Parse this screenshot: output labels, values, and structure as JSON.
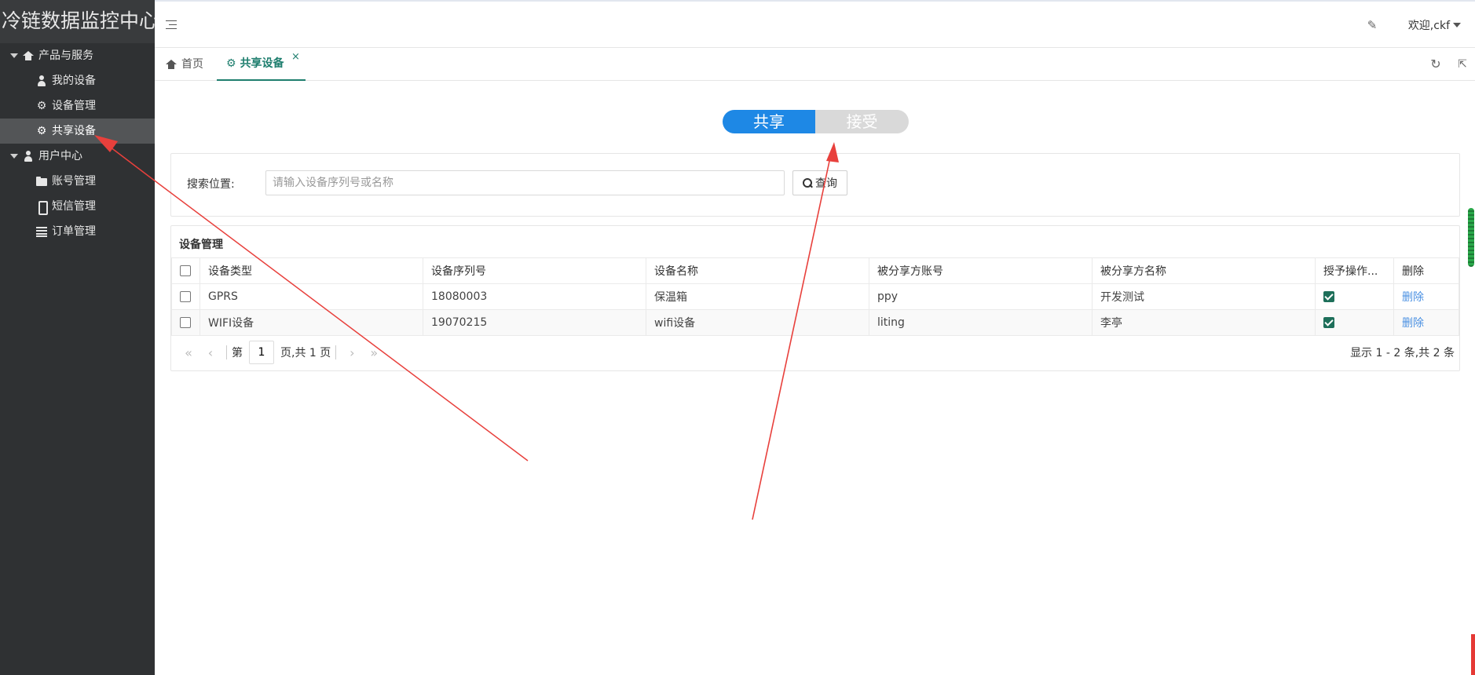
{
  "app": {
    "title": "冷链数据监控中心"
  },
  "sidebar": {
    "groups": [
      {
        "label": "产品与服务",
        "items": [
          {
            "label": "我的设备"
          },
          {
            "label": "设备管理"
          },
          {
            "label": "共享设备"
          }
        ]
      },
      {
        "label": "用户中心",
        "items": [
          {
            "label": "账号管理"
          },
          {
            "label": "短信管理"
          },
          {
            "label": "订单管理"
          }
        ]
      }
    ]
  },
  "header": {
    "welcome": "欢迎,ckf"
  },
  "tabs": [
    {
      "label": "首页"
    },
    {
      "label": "共享设备",
      "close": "×"
    }
  ],
  "toggle": {
    "share": "共享",
    "receive": "接受"
  },
  "search": {
    "label": "搜索位置:",
    "placeholder": "请输入设备序列号或名称",
    "value": "",
    "button": "查询"
  },
  "table": {
    "title": "设备管理",
    "columns": [
      "设备类型",
      "设备序列号",
      "设备名称",
      "被分享方账号",
      "被分享方名称",
      "授予操作...",
      "删除"
    ],
    "rows": [
      {
        "type": "GPRS",
        "serial": "18080003",
        "name": "保温箱",
        "account": "ppy",
        "account_name": "开发测试",
        "granted": true,
        "delete": "删除"
      },
      {
        "type": "WIFI设备",
        "serial": "19070215",
        "name": "wifi设备",
        "account": "liting",
        "account_name": "李亭",
        "granted": true,
        "delete": "删除"
      }
    ]
  },
  "pagination": {
    "prefix": "第",
    "page": "1",
    "suffix": "页,共 1 页",
    "info": "显示 1 - 2 条,共 2 条"
  },
  "colors": {
    "sidebar_bg": "#2f3133",
    "accent_tab": "#1e7e6e",
    "toggle_on": "#1e88e5",
    "toggle_off": "#d9d9d9",
    "link": "#4a90e2",
    "annotation": "#e8403c"
  },
  "icons": {
    "menu_toggle": "hamburger-icon",
    "skin": "palette-icon",
    "refresh": "refresh-icon",
    "popout": "external-link-icon"
  }
}
